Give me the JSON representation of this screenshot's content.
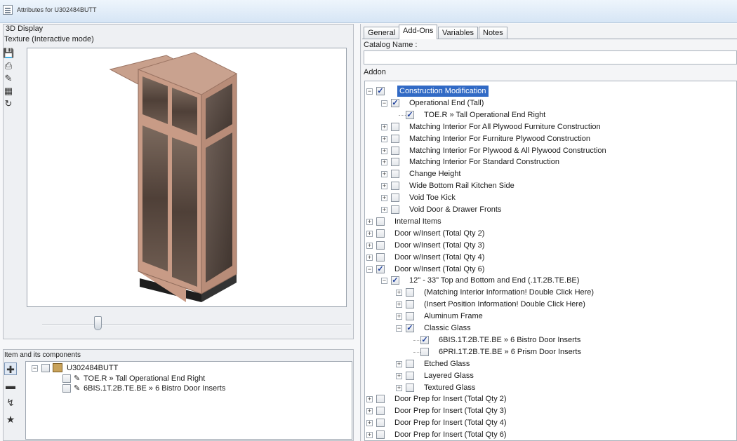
{
  "window": {
    "title": "Attributes for U302484BUTT"
  },
  "display": {
    "header": "3D Display",
    "mode": "Texture (Interactive mode)",
    "tools": [
      "save-icon",
      "print-icon",
      "edit-icon",
      "print-preview-icon",
      "refresh-icon"
    ],
    "slider": {
      "value": 0.17
    }
  },
  "items_panel": {
    "header": "Item and its components",
    "tools": [
      "add-icon",
      "remove-icon",
      "tree-icon",
      "wand-icon",
      "link-icon"
    ],
    "root": "U302484BUTT",
    "children": [
      "TOE.R » Tall Operational End Right",
      "6BIS.1T.2B.TE.BE » 6 Bistro Door Inserts"
    ]
  },
  "tabs": [
    {
      "label": "General",
      "active": false
    },
    {
      "label": "Add-Ons",
      "active": true
    },
    {
      "label": "Variables",
      "active": false
    },
    {
      "label": "Notes",
      "active": false
    }
  ],
  "catalog_label": "Catalog Name :",
  "addon_label": "Addon",
  "tree": [
    {
      "label": "Construction Modification",
      "level": 0,
      "expanded": true,
      "checked": true,
      "highlight": true
    },
    {
      "label": "Operational End (Tall)",
      "level": 1,
      "expanded": true,
      "checked": true
    },
    {
      "label": "TOE.R » Tall Operational End Right",
      "level": 2,
      "leaf": true,
      "checked": true
    },
    {
      "label": "Matching Interior For All Plywood Furniture Construction",
      "level": 1,
      "expanded": false,
      "checked": false
    },
    {
      "label": "Matching Interior For Furniture Plywood Construction",
      "level": 1,
      "expanded": false,
      "checked": false
    },
    {
      "label": "Matching Interior For Plywood & All Plywood Construction",
      "level": 1,
      "expanded": false,
      "checked": false
    },
    {
      "label": "Matching Interior For Standard Construction",
      "level": 1,
      "expanded": false,
      "checked": false
    },
    {
      "label": "Change Height",
      "level": 1,
      "expanded": false,
      "checked": false
    },
    {
      "label": "Wide Bottom Rail Kitchen Side",
      "level": 1,
      "expanded": false,
      "checked": false
    },
    {
      "label": "Void Toe Kick",
      "level": 1,
      "expanded": false,
      "checked": false
    },
    {
      "label": "Void Door & Drawer Fronts",
      "level": 1,
      "expanded": false,
      "checked": false
    },
    {
      "label": "Internal Items",
      "level": 0,
      "expanded": false,
      "checked": false
    },
    {
      "label": "Door w/Insert (Total Qty 2)",
      "level": 0,
      "expanded": false,
      "checked": false
    },
    {
      "label": "Door w/Insert (Total Qty 3)",
      "level": 0,
      "expanded": false,
      "checked": false
    },
    {
      "label": "Door w/Insert (Total Qty 4)",
      "level": 0,
      "expanded": false,
      "checked": false
    },
    {
      "label": "Door w/Insert (Total Qty 6)",
      "level": 0,
      "expanded": true,
      "checked": true
    },
    {
      "label": "12\" - 33\" Top and Bottom and End (.1T.2B.TE.BE)",
      "level": 1,
      "expanded": true,
      "checked": true
    },
    {
      "label": "(Matching Interior Information! Double Click Here)",
      "level": 2,
      "expanded": false,
      "checked": false
    },
    {
      "label": "(Insert Position Information! Double Click Here)",
      "level": 2,
      "expanded": false,
      "checked": false
    },
    {
      "label": "Aluminum Frame",
      "level": 2,
      "expanded": false,
      "checked": false
    },
    {
      "label": "Classic Glass",
      "level": 2,
      "expanded": true,
      "checked": true
    },
    {
      "label": "6BIS.1T.2B.TE.BE » 6 Bistro Door Inserts",
      "level": 3,
      "leaf": true,
      "checked": true
    },
    {
      "label": "6PRI.1T.2B.TE.BE » 6 Prism Door Inserts",
      "level": 3,
      "leaf": true,
      "checked": false
    },
    {
      "label": "Etched Glass",
      "level": 2,
      "expanded": false,
      "checked": false
    },
    {
      "label": "Layered Glass",
      "level": 2,
      "expanded": false,
      "checked": false
    },
    {
      "label": "Textured Glass",
      "level": 2,
      "expanded": false,
      "checked": false
    },
    {
      "label": "Door Prep for Insert (Total Qty 2)",
      "level": 0,
      "expanded": false,
      "checked": false
    },
    {
      "label": "Door Prep for Insert (Total Qty 3)",
      "level": 0,
      "expanded": false,
      "checked": false
    },
    {
      "label": "Door Prep for Insert (Total Qty 4)",
      "level": 0,
      "expanded": false,
      "checked": false
    },
    {
      "label": "Door Prep for Insert (Total Qty 6)",
      "level": 0,
      "expanded": false,
      "checked": false
    }
  ],
  "colors": {
    "highlight": "#316ac5",
    "cabinet_frame": "#c89b86",
    "cabinet_glass": "#5a4a40",
    "cabinet_base": "#2a2a2a"
  }
}
